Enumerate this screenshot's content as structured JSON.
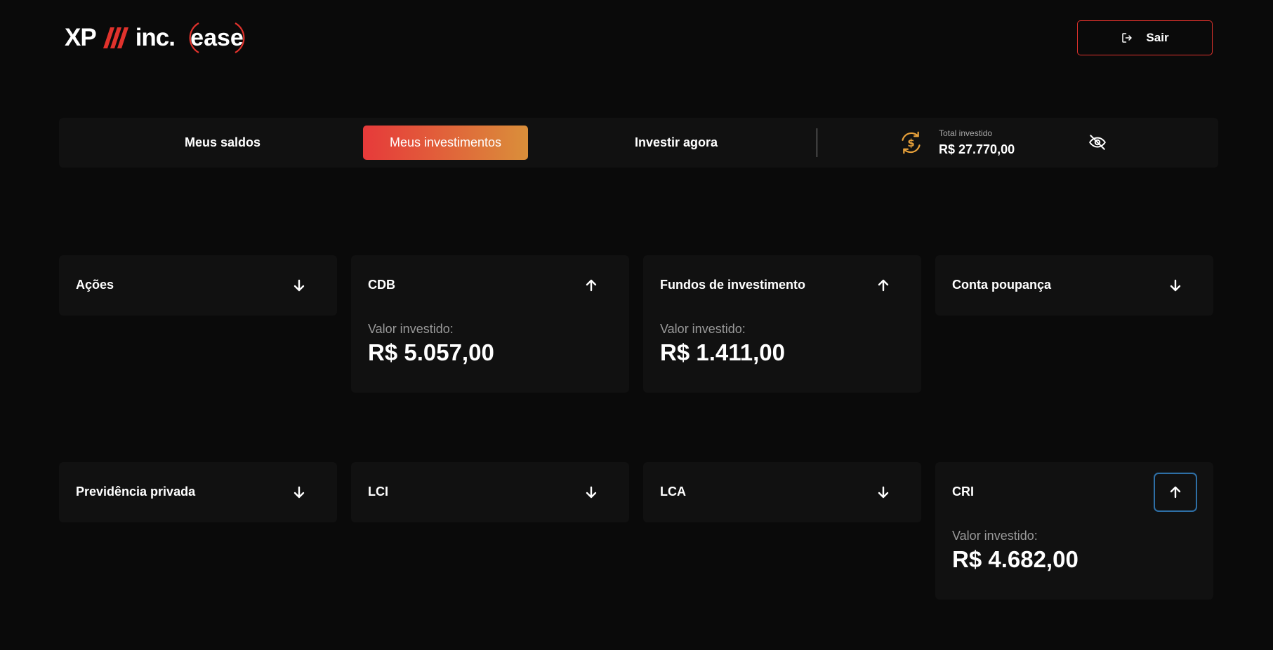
{
  "header": {
    "logo": {
      "brand": "XP",
      "suffix": "inc.",
      "product": "ease"
    },
    "logout": {
      "label": "Sair",
      "icon": "logout-icon"
    }
  },
  "nav": {
    "tabs": [
      {
        "label": "Meus saldos",
        "active": false
      },
      {
        "label": "Meus investimentos",
        "active": true
      },
      {
        "label": "Investir agora",
        "active": false
      }
    ],
    "total": {
      "icon": "currency-exchange-icon",
      "label": "Total investido",
      "value": "R$ 27.770,00"
    },
    "visibility_icon": "eye-off-icon"
  },
  "cards": [
    {
      "title": "Ações",
      "expanded": false,
      "arrow": "arrow-down-icon"
    },
    {
      "title": "CDB",
      "expanded": true,
      "arrow": "arrow-up-icon",
      "label": "Valor investido:",
      "amount": "R$ 5.057,00"
    },
    {
      "title": "Fundos de investimento",
      "expanded": true,
      "arrow": "arrow-up-icon",
      "label": "Valor investido:",
      "amount": "R$ 1.411,00"
    },
    {
      "title": "Conta poupança",
      "expanded": false,
      "arrow": "arrow-down-icon"
    },
    {
      "title": "Previdência privada",
      "expanded": false,
      "arrow": "arrow-down-icon"
    },
    {
      "title": "LCI",
      "expanded": false,
      "arrow": "arrow-down-icon"
    },
    {
      "title": "LCA",
      "expanded": false,
      "arrow": "arrow-down-icon"
    },
    {
      "title": "CRI",
      "expanded": true,
      "arrow": "arrow-up-icon",
      "label": "Valor investido:",
      "amount": "R$ 4.682,00"
    }
  ],
  "colors": {
    "background": "#0a0a0a",
    "card": "#111111",
    "accent_red": "#e0322c",
    "accent_orange": "#da8f3a",
    "focus_ring": "#2e6fa6"
  }
}
